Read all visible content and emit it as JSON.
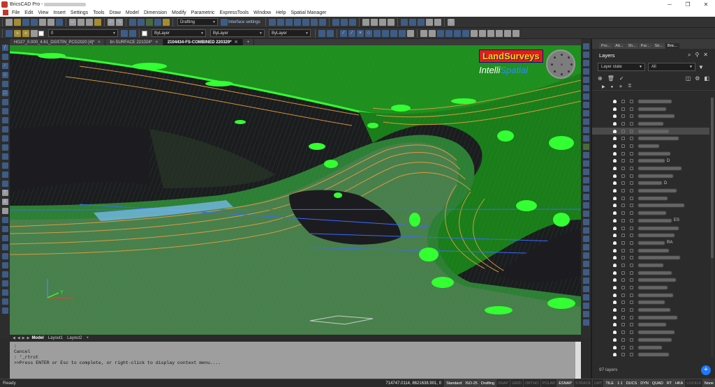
{
  "app": {
    "title": "BricsCAD Pro -"
  },
  "menu": [
    "File",
    "Edit",
    "View",
    "Insert",
    "Settings",
    "Tools",
    "Draw",
    "Model",
    "Dimension",
    "Modify",
    "Parametric",
    "ExpressTools",
    "Window",
    "Help",
    "Spatial Manager"
  ],
  "toolbar": {
    "layer_value": "0",
    "color_value": "ByLayer",
    "workspace": "Drafting",
    "interface_settings": "Interface settings",
    "linetype_value": "ByLayer",
    "lineweight_value": "ByLayer"
  },
  "doc_tabs": [
    {
      "label": "HG27_0.000_4.61_DGSTIN_PCG2020 [4]*",
      "active": false
    },
    {
      "label": "tin SURFACE 221024*",
      "active": false
    },
    {
      "label": "2104434-FS-COMBINED 220329*",
      "active": true
    }
  ],
  "logo": {
    "land": "Land",
    "surveys": "Surveys",
    "intelli": "Intelli",
    "spatial": "Spatial"
  },
  "ucs": {
    "x": "X",
    "y": "Y"
  },
  "layout_tabs": {
    "model": "Model",
    "layout1": "Layout1",
    "layout2": "Layout2",
    "add": "+"
  },
  "command": {
    "line1": ":",
    "line2": "Cancel",
    "line3": ": '_rtrot",
    "line4": ">>Press ENTER or Esc to complete, or right-click to display context menu...."
  },
  "panel": {
    "tabs": [
      "Pro...",
      "Att...",
      "Sh...",
      "Par...",
      "Str...",
      "Bric..."
    ],
    "title": "Layers",
    "layer_state": "Layer state",
    "filter": "All",
    "count": "97 layers",
    "visible_name_fragments": [
      "D",
      "D",
      "ES",
      "RA"
    ]
  },
  "status": {
    "left": "Ready",
    "coords": "714747.0114, 8621638.901, 0",
    "items": [
      {
        "label": "Standard",
        "state": "on"
      },
      {
        "label": "ISO-25",
        "state": "on"
      },
      {
        "label": "Drafting",
        "state": "on"
      },
      {
        "label": "SNAP",
        "state": "off"
      },
      {
        "label": "GRID",
        "state": "off"
      },
      {
        "label": "ORTHO",
        "state": "off"
      },
      {
        "label": "POLAR",
        "state": "off"
      },
      {
        "label": "ESNAP",
        "state": "on"
      },
      {
        "label": "STRACK",
        "state": "off"
      },
      {
        "label": "LWT",
        "state": "off"
      },
      {
        "label": "TILE",
        "state": "on"
      },
      {
        "label": "1:1",
        "state": "on"
      },
      {
        "label": "DUCS",
        "state": "on"
      },
      {
        "label": "DYN",
        "state": "on"
      },
      {
        "label": "QUAD",
        "state": "on"
      },
      {
        "label": "RT",
        "state": "on"
      },
      {
        "label": "HKA",
        "state": "on"
      },
      {
        "label": "LOCKUI",
        "state": "off"
      },
      {
        "label": "None",
        "state": "on"
      }
    ]
  },
  "colors": {
    "surface": "#1f8f1f",
    "highlight": "#33ff33",
    "contour": "#e8a040",
    "accent": "#1e78ff"
  }
}
